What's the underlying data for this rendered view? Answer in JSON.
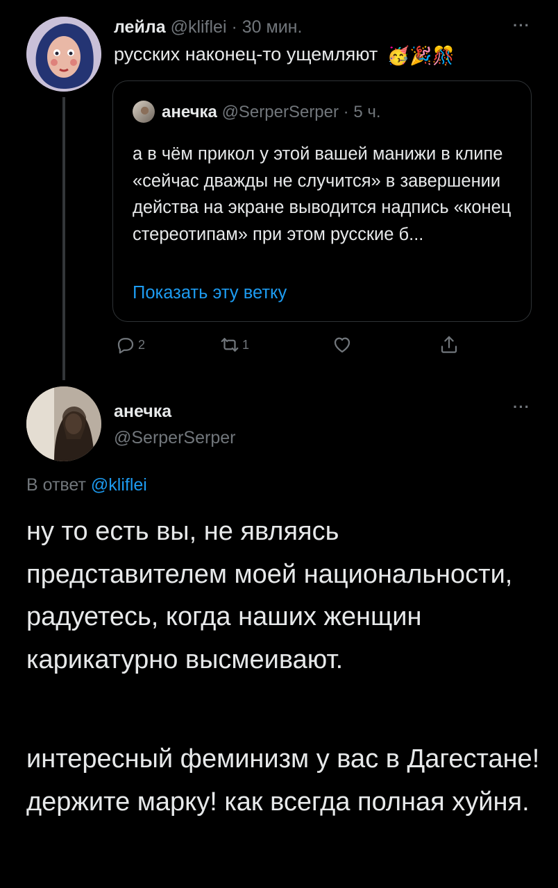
{
  "tweet1": {
    "display_name": "лейла",
    "handle": "@kliflei",
    "separator": "·",
    "time": "30 мин.",
    "text": "русских наконец-то ущемляют",
    "emojis": "🥳🎉🎊",
    "quote": {
      "display_name": "анечка",
      "handle": "@SerperSerper",
      "time": "5 ч.",
      "text": "а в чём прикол у этой вашей манижи в клипе «сейчас дважды не случится» в завершении действа на экране выводится надпись «конец стереотипам» при этом русские б...",
      "show_thread": "Показать эту ветку"
    },
    "actions": {
      "reply_count": "2",
      "retweet_count": "1"
    }
  },
  "tweet2": {
    "display_name": "анечка",
    "handle": "@SerperSerper",
    "replying_prefix": "В ответ",
    "replying_to": "@kliflei",
    "paragraph1": "ну то есть вы, не являясь представителем моей национальности, радуетесь, когда наших женщин карикатурно высмеивают.",
    "paragraph2": "интересный феминизм у вас в Дагестане! держите марку! как всегда полная хуйня."
  },
  "icons": {
    "more": "more-icon",
    "reply": "reply-icon",
    "retweet": "retweet-icon",
    "like": "heart-icon",
    "share": "share-icon"
  },
  "colors": {
    "background": "#000000",
    "text": "#e7e9ea",
    "muted": "#71767b",
    "link": "#1d9bf0",
    "border": "#2f3336"
  }
}
